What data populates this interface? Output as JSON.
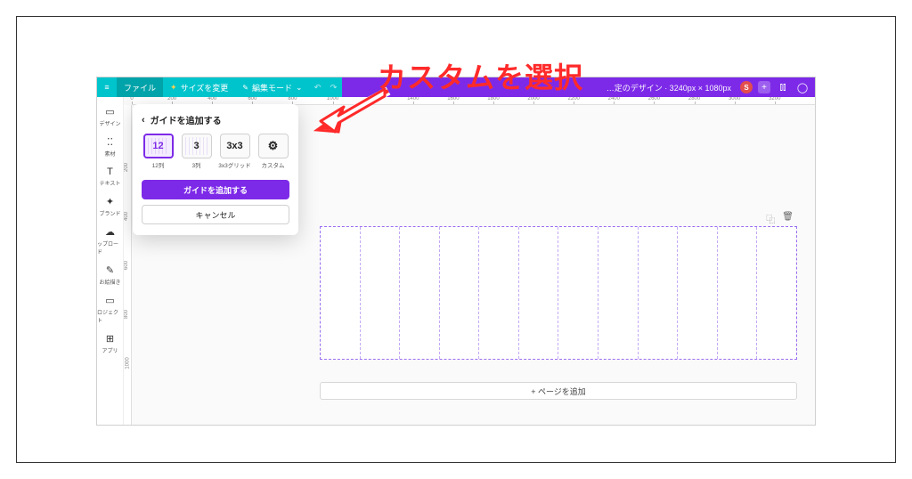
{
  "annotation": {
    "text": "カスタムを選択"
  },
  "topbar": {
    "file": "ファイル",
    "resize": "サイズを変更",
    "edit_mode": "編集モード",
    "design_title": "…定のデザイン · 3240px × 1080px",
    "avatar_letter": "S"
  },
  "sidenav": [
    {
      "icon": "▭",
      "label": "デザイン"
    },
    {
      "icon": "⁚⁚",
      "label": "素材"
    },
    {
      "icon": "T",
      "label": "テキスト"
    },
    {
      "icon": "✦",
      "label": "ブランド"
    },
    {
      "icon": "☁",
      "label": "ップロード"
    },
    {
      "icon": "✎",
      "label": "お絵描き"
    },
    {
      "icon": "▭",
      "label": "ロジェクト"
    },
    {
      "icon": "⊞",
      "label": "アプリ"
    }
  ],
  "ruler_h": [
    0,
    200,
    400,
    600,
    800,
    1000,
    1200,
    1400,
    1600,
    1800,
    2000,
    2200,
    2400,
    2600,
    2800,
    3000,
    3200
  ],
  "ruler_v": [
    200,
    400,
    600,
    800,
    1000
  ],
  "popover": {
    "title": "ガイドを追加する",
    "options": [
      {
        "value": "12",
        "label_below": "12列",
        "selected": true,
        "cls": "cols"
      },
      {
        "value": "3",
        "label_below": "3列",
        "selected": false,
        "cls": "cols"
      },
      {
        "value": "3x3",
        "label_below": "3x3グリッド",
        "selected": false,
        "cls": ""
      },
      {
        "value": "⚙",
        "label_below": "カスタム",
        "selected": false,
        "cls": "custom"
      }
    ],
    "primary": "ガイドを追加する",
    "secondary": "キャンセル"
  },
  "canvas": {
    "add_page": "+ ページを追加",
    "columns": 12
  }
}
